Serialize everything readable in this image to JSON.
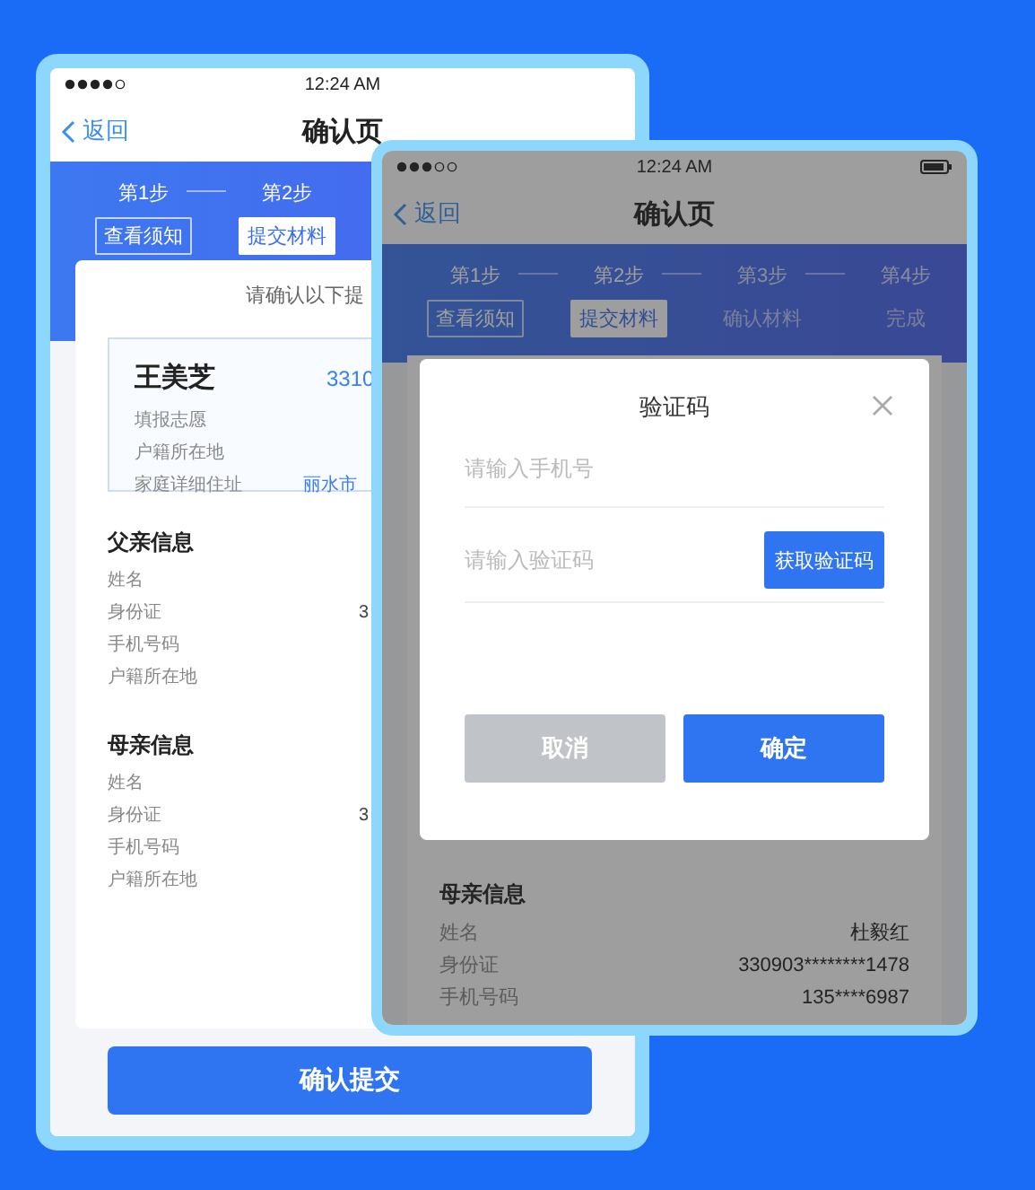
{
  "left_phone": {
    "status_bar": {
      "time": "12:24 AM"
    },
    "nav": {
      "back": "返回",
      "title": "确认页"
    },
    "steps": [
      {
        "label": "第1步",
        "reached": true
      },
      {
        "label": "第2步",
        "reached": true
      }
    ],
    "tabs": [
      {
        "label": "查看须知",
        "selected": false,
        "reached": true
      },
      {
        "label": "提交材料",
        "selected": true,
        "reached": true
      }
    ],
    "prompt": "请确认以下提",
    "applicant": {
      "name": "王美芝",
      "id": "3310",
      "rows": [
        {
          "label": "填报志愿"
        },
        {
          "label": "户籍所在地"
        },
        {
          "label": "家庭详细住址",
          "value": "丽水市"
        }
      ]
    },
    "sections": [
      {
        "title": "父亲信息",
        "rows": [
          {
            "label": "姓名"
          },
          {
            "label": "身份证",
            "value": "3"
          },
          {
            "label": "手机号码"
          },
          {
            "label": "户籍所在地"
          }
        ]
      },
      {
        "title": "母亲信息",
        "rows": [
          {
            "label": "姓名"
          },
          {
            "label": "身份证",
            "value": "3"
          },
          {
            "label": "手机号码"
          },
          {
            "label": "户籍所在地"
          }
        ]
      }
    ],
    "submit": "确认提交"
  },
  "right_phone": {
    "status_bar": {
      "time": "12:24 AM"
    },
    "nav": {
      "back": "返回",
      "title": "确认页"
    },
    "steps": [
      {
        "label": "第1步",
        "reached": true
      },
      {
        "label": "第2步",
        "reached": true
      },
      {
        "label": "第3步",
        "reached": false
      },
      {
        "label": "第4步",
        "reached": false
      }
    ],
    "tabs": [
      {
        "label": "查看须知",
        "selected": false,
        "reached": true
      },
      {
        "label": "提交材料",
        "selected": true,
        "reached": true
      },
      {
        "label": "确认材料",
        "selected": false,
        "reached": false
      },
      {
        "label": "完成",
        "selected": false,
        "reached": false
      }
    ],
    "section": {
      "title": "母亲信息",
      "rows": [
        {
          "label": "姓名",
          "value": "杜毅红"
        },
        {
          "label": "身份证",
          "value": "330903********1478"
        },
        {
          "label": "手机号码",
          "value": "135****6987"
        }
      ]
    },
    "dialog": {
      "title": "验证码",
      "phone": {
        "placeholder": "请输入手机号"
      },
      "code": {
        "placeholder": "请输入验证码"
      },
      "get_code": "获取验证码",
      "cancel": "取消",
      "confirm": "确定"
    }
  }
}
